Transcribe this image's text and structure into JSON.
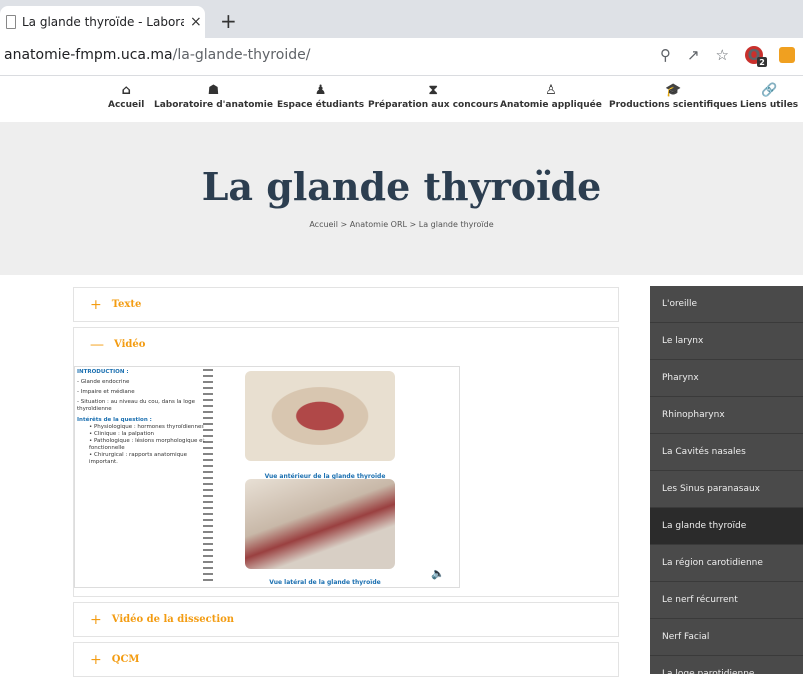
{
  "browser": {
    "tab_title": "La glande thyroïde - Laboratoire",
    "tab_close": "×",
    "new_tab": "+",
    "url_host": "anatomie-fmpm.uca.ma",
    "url_path": "/la-glande-thyroide/",
    "ext_badge": "2"
  },
  "nav": {
    "items": [
      {
        "label": "Accueil",
        "icon": "home-icon",
        "glyph": "⌂"
      },
      {
        "label": "Laboratoire d'anatomie",
        "icon": "users-icon",
        "glyph": "☗"
      },
      {
        "label": "Espace étudiants",
        "icon": "student-icon",
        "glyph": "♟"
      },
      {
        "label": "Préparation aux concours",
        "icon": "hourglass-icon",
        "glyph": "⧗"
      },
      {
        "label": "Anatomie appliquée",
        "icon": "doctor-icon",
        "glyph": "♙"
      },
      {
        "label": "Productions scientifiques",
        "icon": "graduation-cap-icon",
        "glyph": "🎓"
      },
      {
        "label": "Liens utiles",
        "icon": "link-icon",
        "glyph": "🔗"
      }
    ]
  },
  "hero": {
    "title": "La glande thyroïde",
    "breadcrumb": "Accueil > Anatomie ORL > La glande thyroïde"
  },
  "accordion": {
    "texte": {
      "sign": "+",
      "label": "Texte"
    },
    "video": {
      "sign": "—",
      "label": "Vidéo"
    },
    "dissection": {
      "sign": "+",
      "label": "Vidéo de la dissection"
    },
    "qcm": {
      "sign": "+",
      "label": "QCM"
    }
  },
  "slide": {
    "heading": "INTRODUCTION :",
    "line1": "- Glande endocrine",
    "line2": "- Impaire et médiane",
    "line3": "- Situation : au niveau du cou, dans la loge thyroïdienne",
    "interest": "Intérêts de la question :",
    "b1": "• Physiologique : hormones thyroïdiennes",
    "b2": "• Clinique : la palpation",
    "b3": "• Pathologique : lésions morphologique et fonctionnelle",
    "b4": "• Chirurgical : rapports anatomique important.",
    "caption1": "Vue antérieur de la glande thyroïde",
    "caption2": "Vue latéral de la glande thyroïde"
  },
  "sidebar": {
    "items": [
      {
        "label": "L'oreille",
        "active": false
      },
      {
        "label": "Le larynx",
        "active": false
      },
      {
        "label": "Pharynx",
        "active": false
      },
      {
        "label": "Rhinopharynx",
        "active": false
      },
      {
        "label": "La Cavités nasales",
        "active": false
      },
      {
        "label": "Les Sinus paranasaux",
        "active": false
      },
      {
        "label": "La glande thyroïde",
        "active": true
      },
      {
        "label": "La région carotidienne",
        "active": false
      },
      {
        "label": "Le nerf récurrent",
        "active": false
      },
      {
        "label": "Nerf Facial",
        "active": false
      },
      {
        "label": "La loge parotidienne",
        "active": false
      }
    ]
  }
}
